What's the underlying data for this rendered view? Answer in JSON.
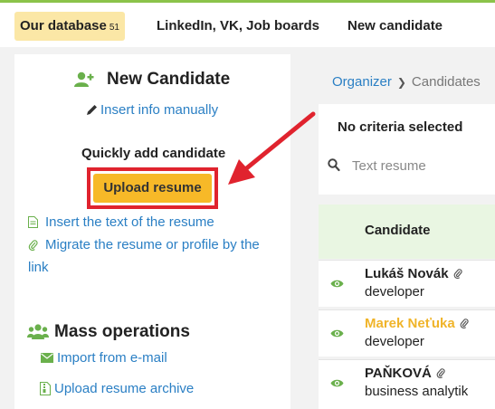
{
  "tabs": [
    {
      "label": "Our database",
      "badge": "51",
      "active": true
    },
    {
      "label": "LinkedIn, VK, Job boards",
      "active": false
    },
    {
      "label": "New candidate",
      "active": false
    }
  ],
  "new_candidate": {
    "title": "New Candidate",
    "insert_manually": "Insert info manually",
    "quick_add_label": "Quickly add candidate",
    "upload_button": "Upload resume",
    "insert_text_link": "Insert the text of the resume",
    "migrate_link": "Migrate the resume or profile by the link"
  },
  "mass_operations": {
    "title": "Mass operations",
    "import_email": "Import from e-mail",
    "upload_archive": "Upload resume archive"
  },
  "breadcrumb": {
    "parent": "Organizer",
    "current": "Candidates"
  },
  "filter": {
    "criteria_text": "No criteria selected",
    "search_placeholder": "Text resume"
  },
  "table": {
    "column_header": "Candidate",
    "rows": [
      {
        "name": "Lukáš Novák",
        "role": "developer",
        "name_color": "#222222"
      },
      {
        "name": "Marek Neťuka",
        "role": "developer",
        "name_color": "#f0b429"
      },
      {
        "name": "PAŇKOVÁ",
        "role": "business analytik",
        "name_color": "#222222"
      }
    ]
  },
  "colors": {
    "accent_green": "#8bc34a",
    "link_blue": "#2a7fc4",
    "button_yellow": "#f7b928",
    "highlight_red": "#e0232e",
    "active_tab_bg": "#fbe7a6"
  }
}
